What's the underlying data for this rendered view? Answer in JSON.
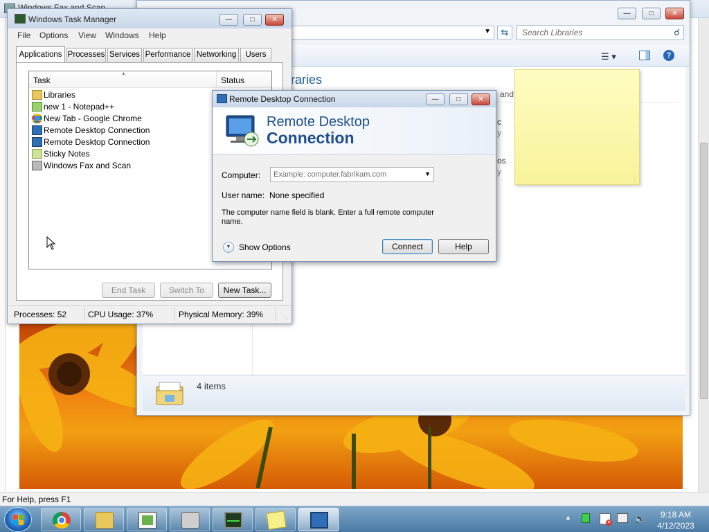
{
  "outer": {
    "title": "Windows Fax and Scan",
    "status_text": "For Help, press F1"
  },
  "explorer": {
    "search_placeholder": "Search Libraries",
    "heading": "raries",
    "desc_fragment": "and",
    "frag1": "c",
    "frag2": "y",
    "frag3": "os",
    "frag4": "y",
    "items_count": "4 items"
  },
  "task_manager": {
    "title": "Windows Task Manager",
    "menu": [
      "File",
      "Options",
      "View",
      "Windows",
      "Help"
    ],
    "tabs": [
      "Applications",
      "Processes",
      "Services",
      "Performance",
      "Networking",
      "Users"
    ],
    "columns": {
      "task": "Task",
      "status": "Status"
    },
    "tasks": [
      {
        "name": "Libraries",
        "icon": "folder-icon"
      },
      {
        "name": "new 1 - Notepad++",
        "icon": "notepad-plus-plus-icon"
      },
      {
        "name": "New Tab - Google Chrome",
        "icon": "chrome-icon"
      },
      {
        "name": "Remote Desktop Connection",
        "icon": "remote-desktop-icon"
      },
      {
        "name": "Remote Desktop Connection",
        "icon": "remote-desktop-icon"
      },
      {
        "name": "Sticky Notes",
        "icon": "sticky-notes-icon"
      },
      {
        "name": "Windows Fax and Scan",
        "icon": "fax-icon"
      }
    ],
    "buttons": {
      "end_task": "End Task",
      "switch_to": "Switch To",
      "new_task": "New Task..."
    },
    "status": {
      "processes": "Processes: 52",
      "cpu": "CPU Usage: 37%",
      "memory": "Physical Memory: 39%"
    }
  },
  "rdc": {
    "title": "Remote Desktop Connection",
    "banner_line1": "Remote Desktop",
    "banner_line2": "Connection",
    "computer_label": "Computer:",
    "computer_placeholder": "Example: computer.fabrikam.com",
    "username_label": "User name:",
    "username_value": "None specified",
    "message": "The computer name field is blank. Enter a full remote computer name.",
    "show_options": "Show Options",
    "connect": "Connect",
    "help": "Help"
  },
  "taskbar": {
    "items": [
      "start-orb",
      "chrome",
      "libraries",
      "notepad-plus-plus",
      "fax-and-scan",
      "task-manager",
      "sticky-notes",
      "remote-desktop"
    ],
    "time": "9:18 AM",
    "date": "4/12/2023"
  },
  "colors": {
    "accent": "#1e4e8c",
    "taskbar": "#4a7aa4",
    "sticky": "#f8f39b"
  }
}
